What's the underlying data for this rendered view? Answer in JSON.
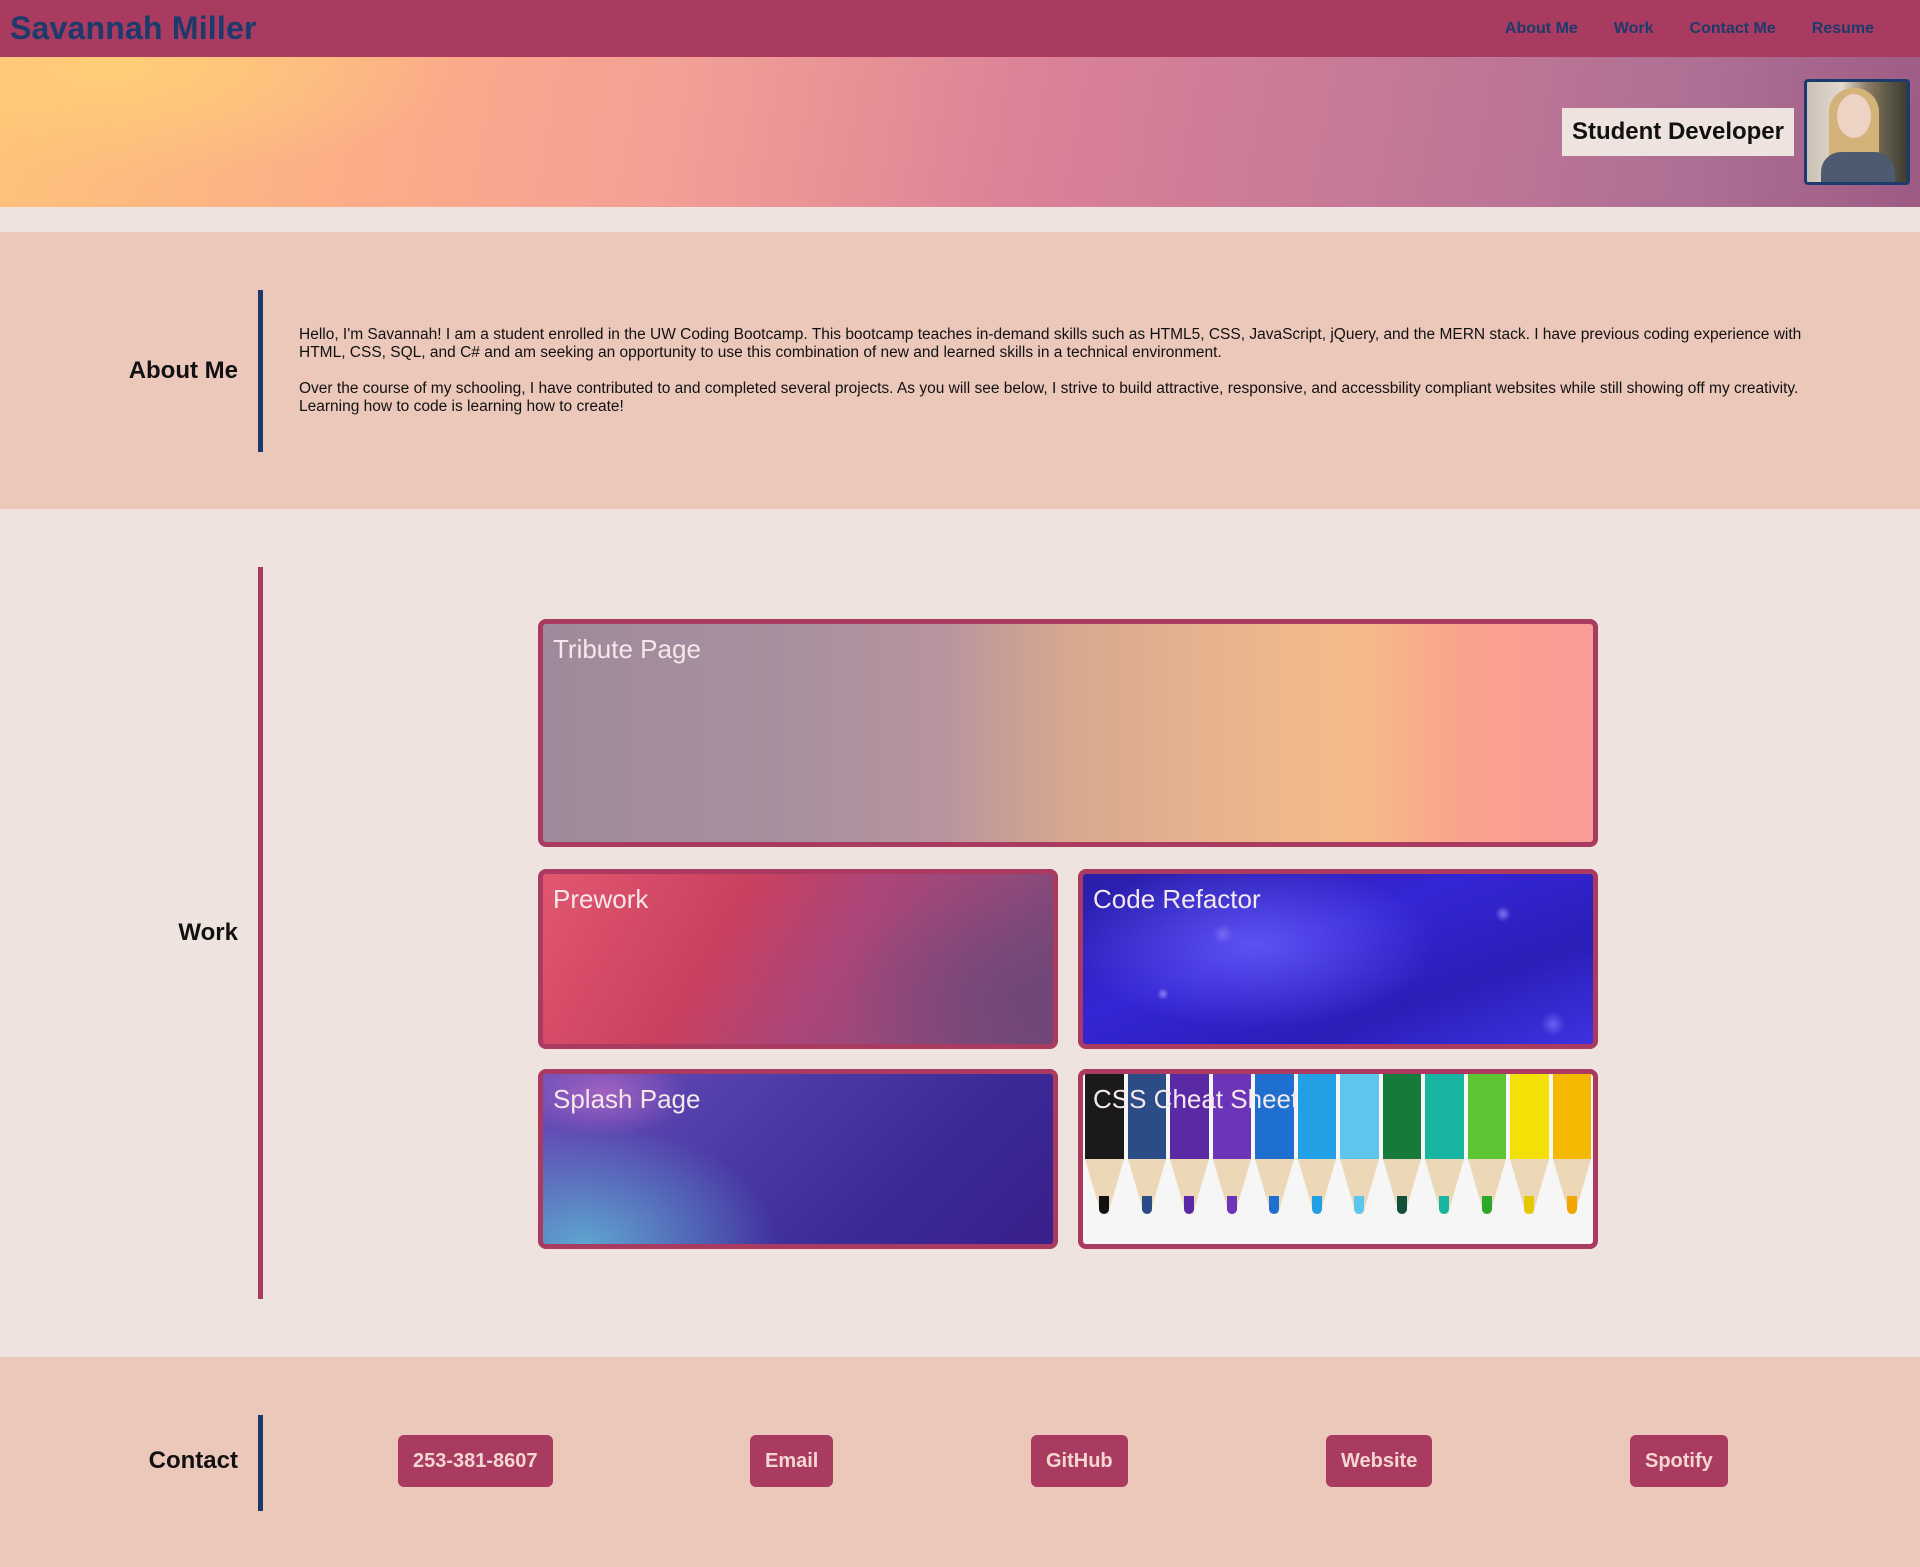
{
  "nav": {
    "brand": "Savannah Miller",
    "links": [
      "About Me",
      "Work",
      "Contact Me",
      "Resume"
    ]
  },
  "hero": {
    "title": "Student Developer"
  },
  "about": {
    "label": "About Me",
    "paragraphs": [
      "Hello, I'm Savannah! I am a student enrolled in the UW Coding Bootcamp. This bootcamp teaches in-demand skills such as HTML5, CSS, JavaScript, jQuery, and the MERN stack. I have previous coding experience with HTML, CSS, SQL, and C# and am seeking an opportunity to use this combination of new and learned skills in a technical environment.",
      "Over the course of my schooling, I have contributed to and completed several projects. As you will see below, I strive to build attractive, responsive, and accessbility compliant websites while still showing off my creativity. Learning how to code is learning how to create!"
    ]
  },
  "work": {
    "label": "Work",
    "projects": [
      "Tribute Page",
      "Prework",
      "Code Refactor",
      "Splash Page",
      "CSS Cheat Sheet"
    ]
  },
  "contact": {
    "label": "Contact",
    "buttons": [
      "253-381-8607",
      "Email",
      "GitHub",
      "Website",
      "Spotify"
    ]
  },
  "colors": {
    "accent": "#a93a60",
    "navy": "#1c3a6b",
    "section_pink": "#ecc8bb",
    "background": "#efe3df"
  }
}
